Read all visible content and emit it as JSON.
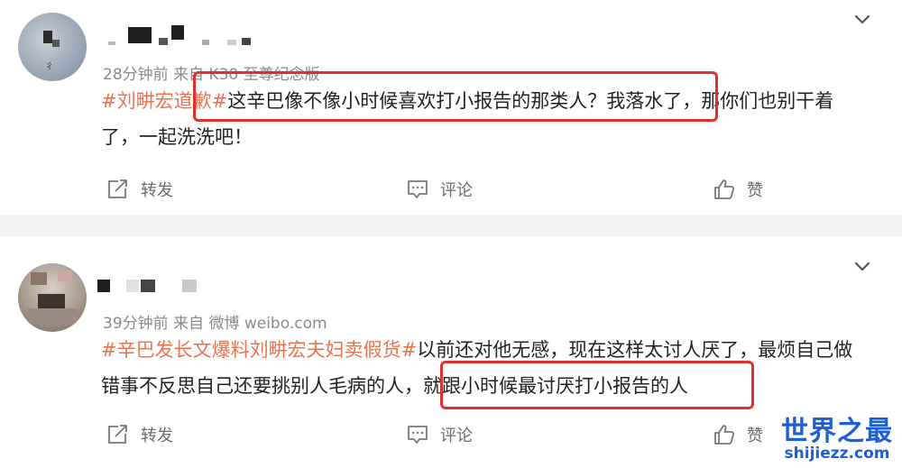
{
  "posts": [
    {
      "meta": "28分钟前  来自 K30 至尊纪念版",
      "tag": "#刘畊宏道歉#",
      "text": "这辛巴像不像小时候喜欢打小报告的那类人？我落水了，那你们也别干着了，一起洗洗吧！",
      "actions": {
        "repost": "转发",
        "comment": "评论",
        "like": "赞"
      }
    },
    {
      "meta": "39分钟前  来自 微博 weibo.com",
      "tag": "#辛巴发长文爆料刘畊宏夫妇卖假货#",
      "text": "以前还对他无感，现在这样太讨人厌了，最烦自己做错事不反思自己还要挑别人毛病的人，就跟小时候最讨厌打小报告的人",
      "actions": {
        "repost": "转发",
        "comment": "评论",
        "like": "赞"
      }
    }
  ],
  "watermark": {
    "title": "世界之最",
    "url": "shijiezz.com"
  },
  "icons": [
    "chevron-down-icon",
    "repost-icon",
    "comment-icon",
    "like-icon"
  ],
  "colors": {
    "tag": "#eb7350",
    "highlight": "#e02f2f",
    "watermark": "#1f5fd6"
  }
}
